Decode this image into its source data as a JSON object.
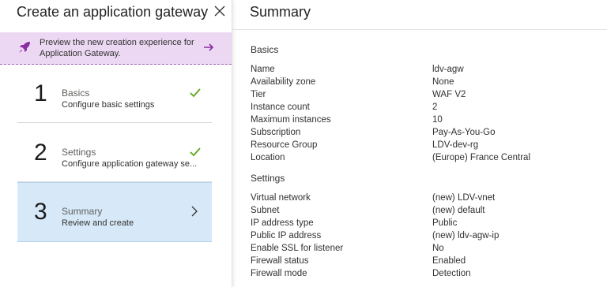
{
  "left_panel": {
    "title": "Create an application gateway",
    "preview_banner": {
      "text": "Preview the new creation experience for Application Gateway."
    },
    "steps": [
      {
        "number": "1",
        "name": "Basics",
        "description": "Configure basic settings",
        "status_icon": "check-icon"
      },
      {
        "number": "2",
        "name": "Settings",
        "description": "Configure application gateway se...",
        "status_icon": "check-icon"
      },
      {
        "number": "3",
        "name": "Summary",
        "description": "Review and create",
        "status_icon": "chevron-right-icon"
      }
    ]
  },
  "summary": {
    "title": "Summary",
    "basics": {
      "heading": "Basics",
      "rows": [
        {
          "key": "Name",
          "value": "ldv-agw"
        },
        {
          "key": "Availability zone",
          "value": "None"
        },
        {
          "key": "Tier",
          "value": "WAF V2"
        },
        {
          "key": "Instance count",
          "value": "2"
        },
        {
          "key": "Maximum instances",
          "value": "10"
        },
        {
          "key": "Subscription",
          "value": "Pay-As-You-Go"
        },
        {
          "key": "Resource Group",
          "value": "LDV-dev-rg"
        },
        {
          "key": "Location",
          "value": "(Europe) France Central"
        }
      ]
    },
    "settings": {
      "heading": "Settings",
      "rows": [
        {
          "key": "Virtual network",
          "value": "(new) LDV-vnet"
        },
        {
          "key": "Subnet",
          "value": "(new) default"
        },
        {
          "key": "IP address type",
          "value": "Public"
        },
        {
          "key": "Public IP address",
          "value": "(new) ldv-agw-ip"
        },
        {
          "key": "Enable SSL for listener",
          "value": "No"
        },
        {
          "key": "Firewall status",
          "value": "Enabled"
        },
        {
          "key": "Firewall mode",
          "value": "Detection"
        }
      ]
    }
  },
  "colors": {
    "banner_bg": "#ecd8f3",
    "accent_purple": "#8a2da5",
    "check_green": "#5ea517",
    "selected_step_bg": "#d7e9f8"
  }
}
